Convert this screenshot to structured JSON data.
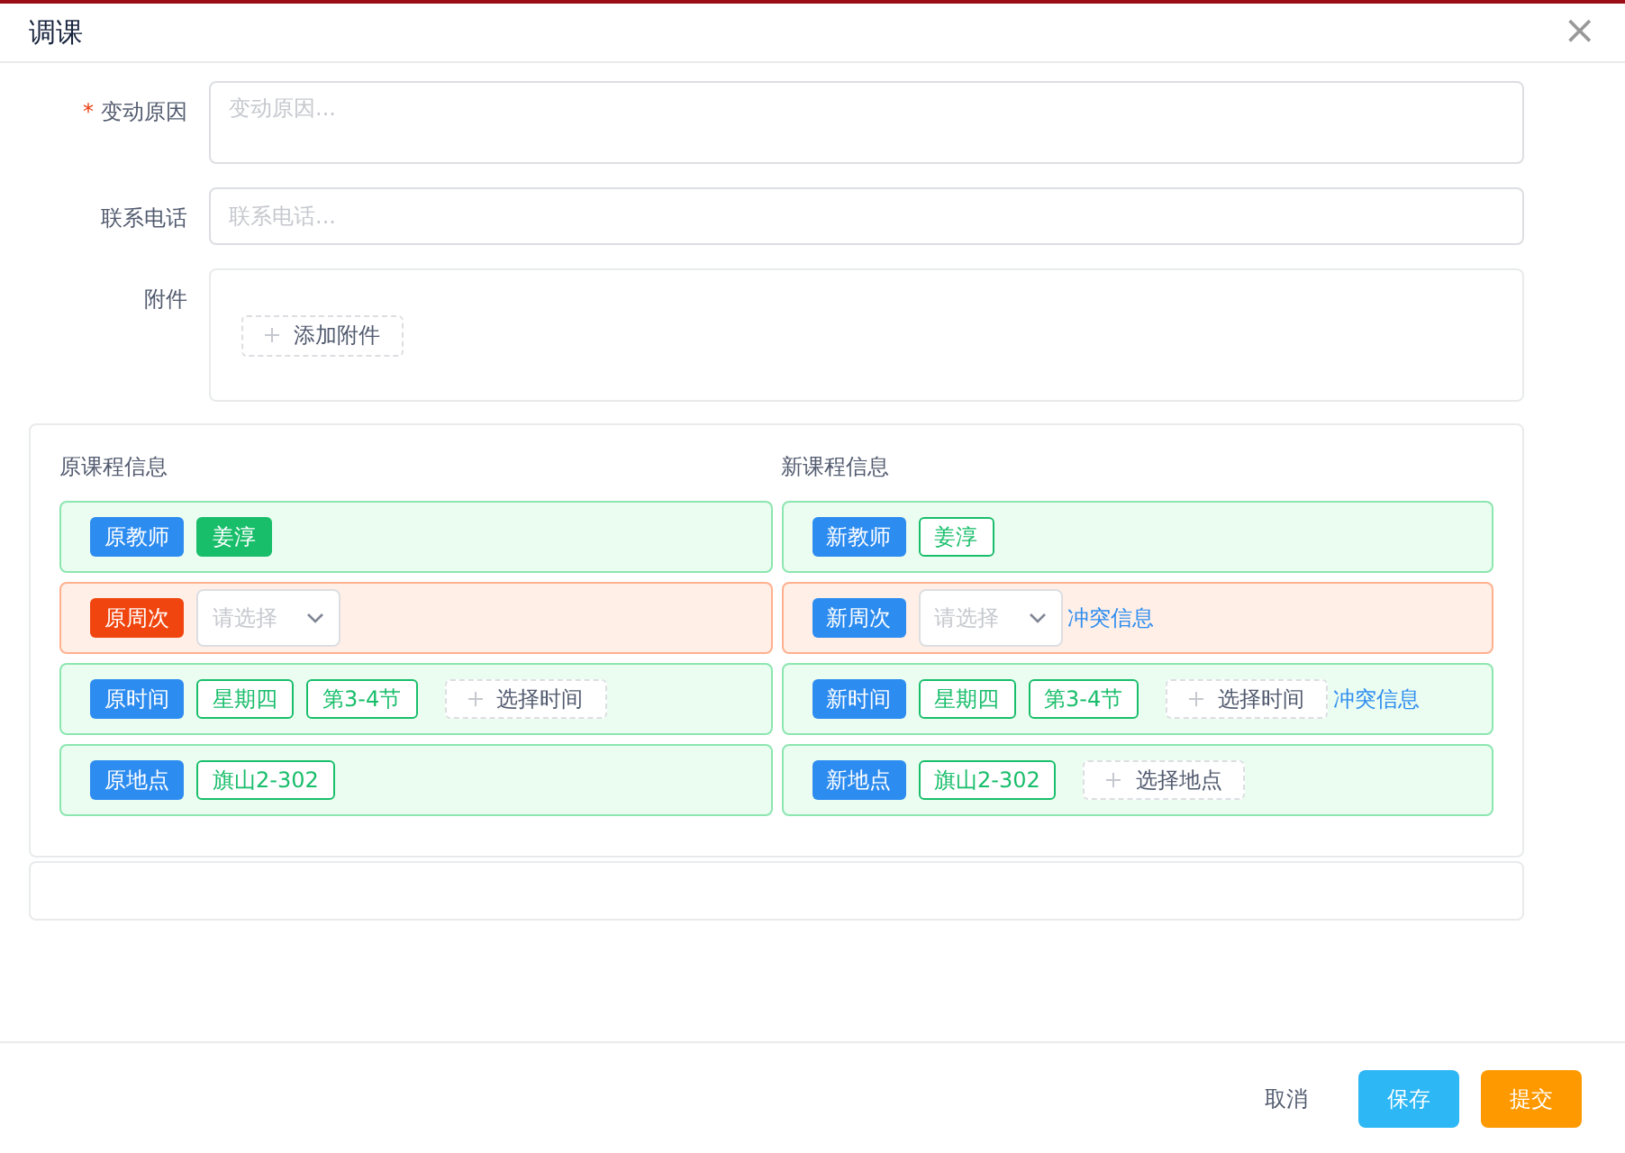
{
  "dialog": {
    "title": "调课",
    "close": "×"
  },
  "form": [
    {
      "kind": "textarea",
      "label": "变动原因",
      "required_mark": "*",
      "placeholder": "变动原因..."
    },
    {
      "kind": "input",
      "label": "联系电话",
      "placeholder": "联系电话..."
    },
    {
      "kind": "attachment",
      "label": "附件",
      "button": "添加附件"
    }
  ],
  "courses": [
    {
      "title": "原课程信息",
      "rows": [
        {
          "conflict": false,
          "label": "原教师",
          "color": "#2d8cf0",
          "items": [
            {
              "kind": "tag",
              "text": "姜淳",
              "filled": true
            }
          ]
        },
        {
          "conflict": true,
          "label": "原周次",
          "color": "#f0450e",
          "items": [
            {
              "kind": "select",
              "placeholder": "请选择"
            }
          ]
        },
        {
          "conflict": false,
          "label": "原时间",
          "color": "#2d8cf0",
          "items": [
            {
              "kind": "tag",
              "text": "星期四",
              "filled": false
            },
            {
              "kind": "tag",
              "text": "第3-4节",
              "filled": false
            },
            {
              "kind": "add",
              "text": "选择时间"
            }
          ]
        },
        {
          "conflict": false,
          "label": "原地点",
          "color": "#2d8cf0",
          "items": [
            {
              "kind": "tag",
              "text": "旗山2-302",
              "filled": false
            }
          ]
        }
      ]
    },
    {
      "title": "新课程信息",
      "rows": [
        {
          "conflict": false,
          "label": "新教师",
          "color": "#2d8cf0",
          "items": [
            {
              "kind": "tag",
              "text": "姜淳",
              "filled": false
            }
          ]
        },
        {
          "conflict": true,
          "label": "新周次",
          "color": "#2d8cf0",
          "items": [
            {
              "kind": "select",
              "placeholder": "请选择"
            },
            {
              "kind": "link",
              "text": "冲突信息"
            }
          ]
        },
        {
          "conflict": false,
          "label": "新时间",
          "color": "#2d8cf0",
          "items": [
            {
              "kind": "tag",
              "text": "星期四",
              "filled": false
            },
            {
              "kind": "tag",
              "text": "第3-4节",
              "filled": false
            },
            {
              "kind": "add",
              "text": "选择时间"
            },
            {
              "kind": "link",
              "text": "冲突信息"
            }
          ]
        },
        {
          "conflict": false,
          "label": "新地点",
          "color": "#2d8cf0",
          "items": [
            {
              "kind": "tag",
              "text": "旗山2-302",
              "filled": false
            },
            {
              "kind": "add",
              "text": "选择地点"
            }
          ]
        }
      ]
    }
  ],
  "footer": {
    "buttons": [
      {
        "kind": "text",
        "label": "取消"
      },
      {
        "kind": "save",
        "label": "保存"
      },
      {
        "kind": "submit",
        "label": "提交"
      }
    ]
  }
}
